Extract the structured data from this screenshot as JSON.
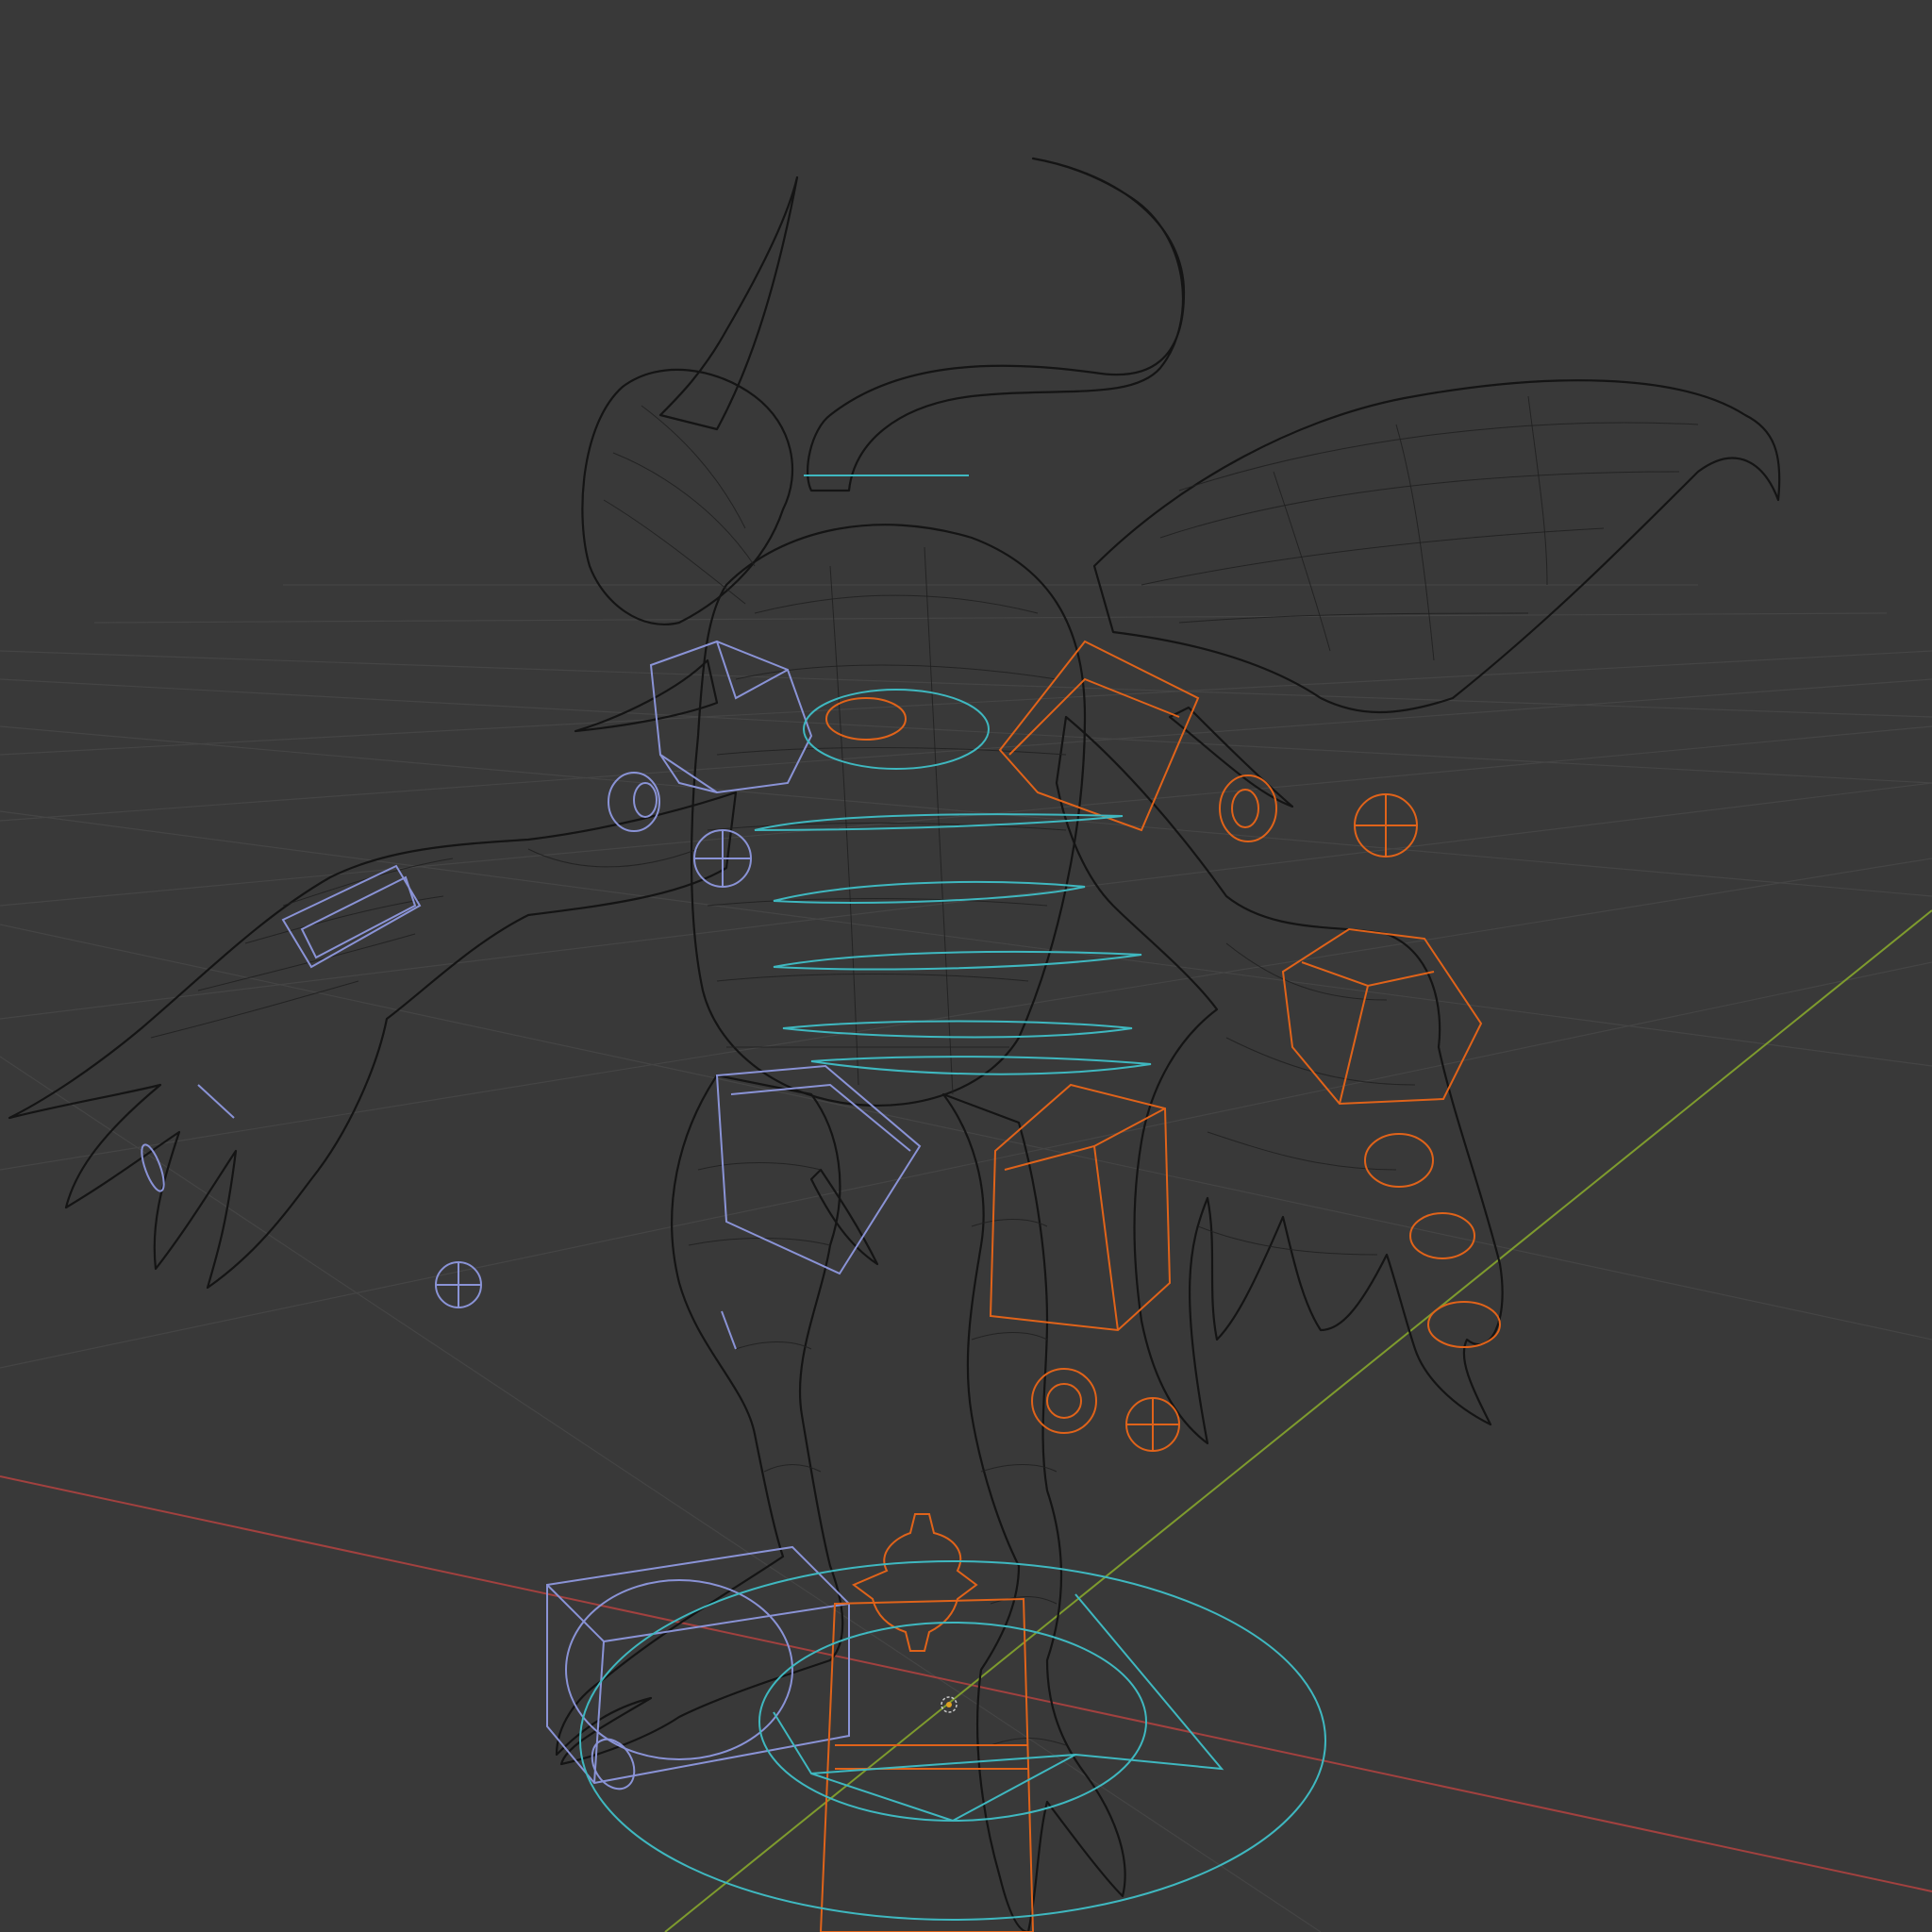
{
  "viewport": {
    "mode": "wireframe",
    "background": "#393939",
    "grid_color": "#454545"
  },
  "colors": {
    "x_axis": "#a2413f",
    "y_axis": "#7e9b2e",
    "mesh_wire": "#141414",
    "rig_left": "#8a93d6",
    "rig_right": "#e0631a",
    "rig_center": "#3fb8c0"
  },
  "objects": [
    {
      "name": "creature-mesh",
      "type": "mesh"
    },
    {
      "name": "armature-left-controls",
      "color": "blue"
    },
    {
      "name": "armature-right-controls",
      "color": "orange"
    },
    {
      "name": "spine-controls",
      "color": "cyan"
    },
    {
      "name": "root-control",
      "color": "cyan"
    }
  ]
}
